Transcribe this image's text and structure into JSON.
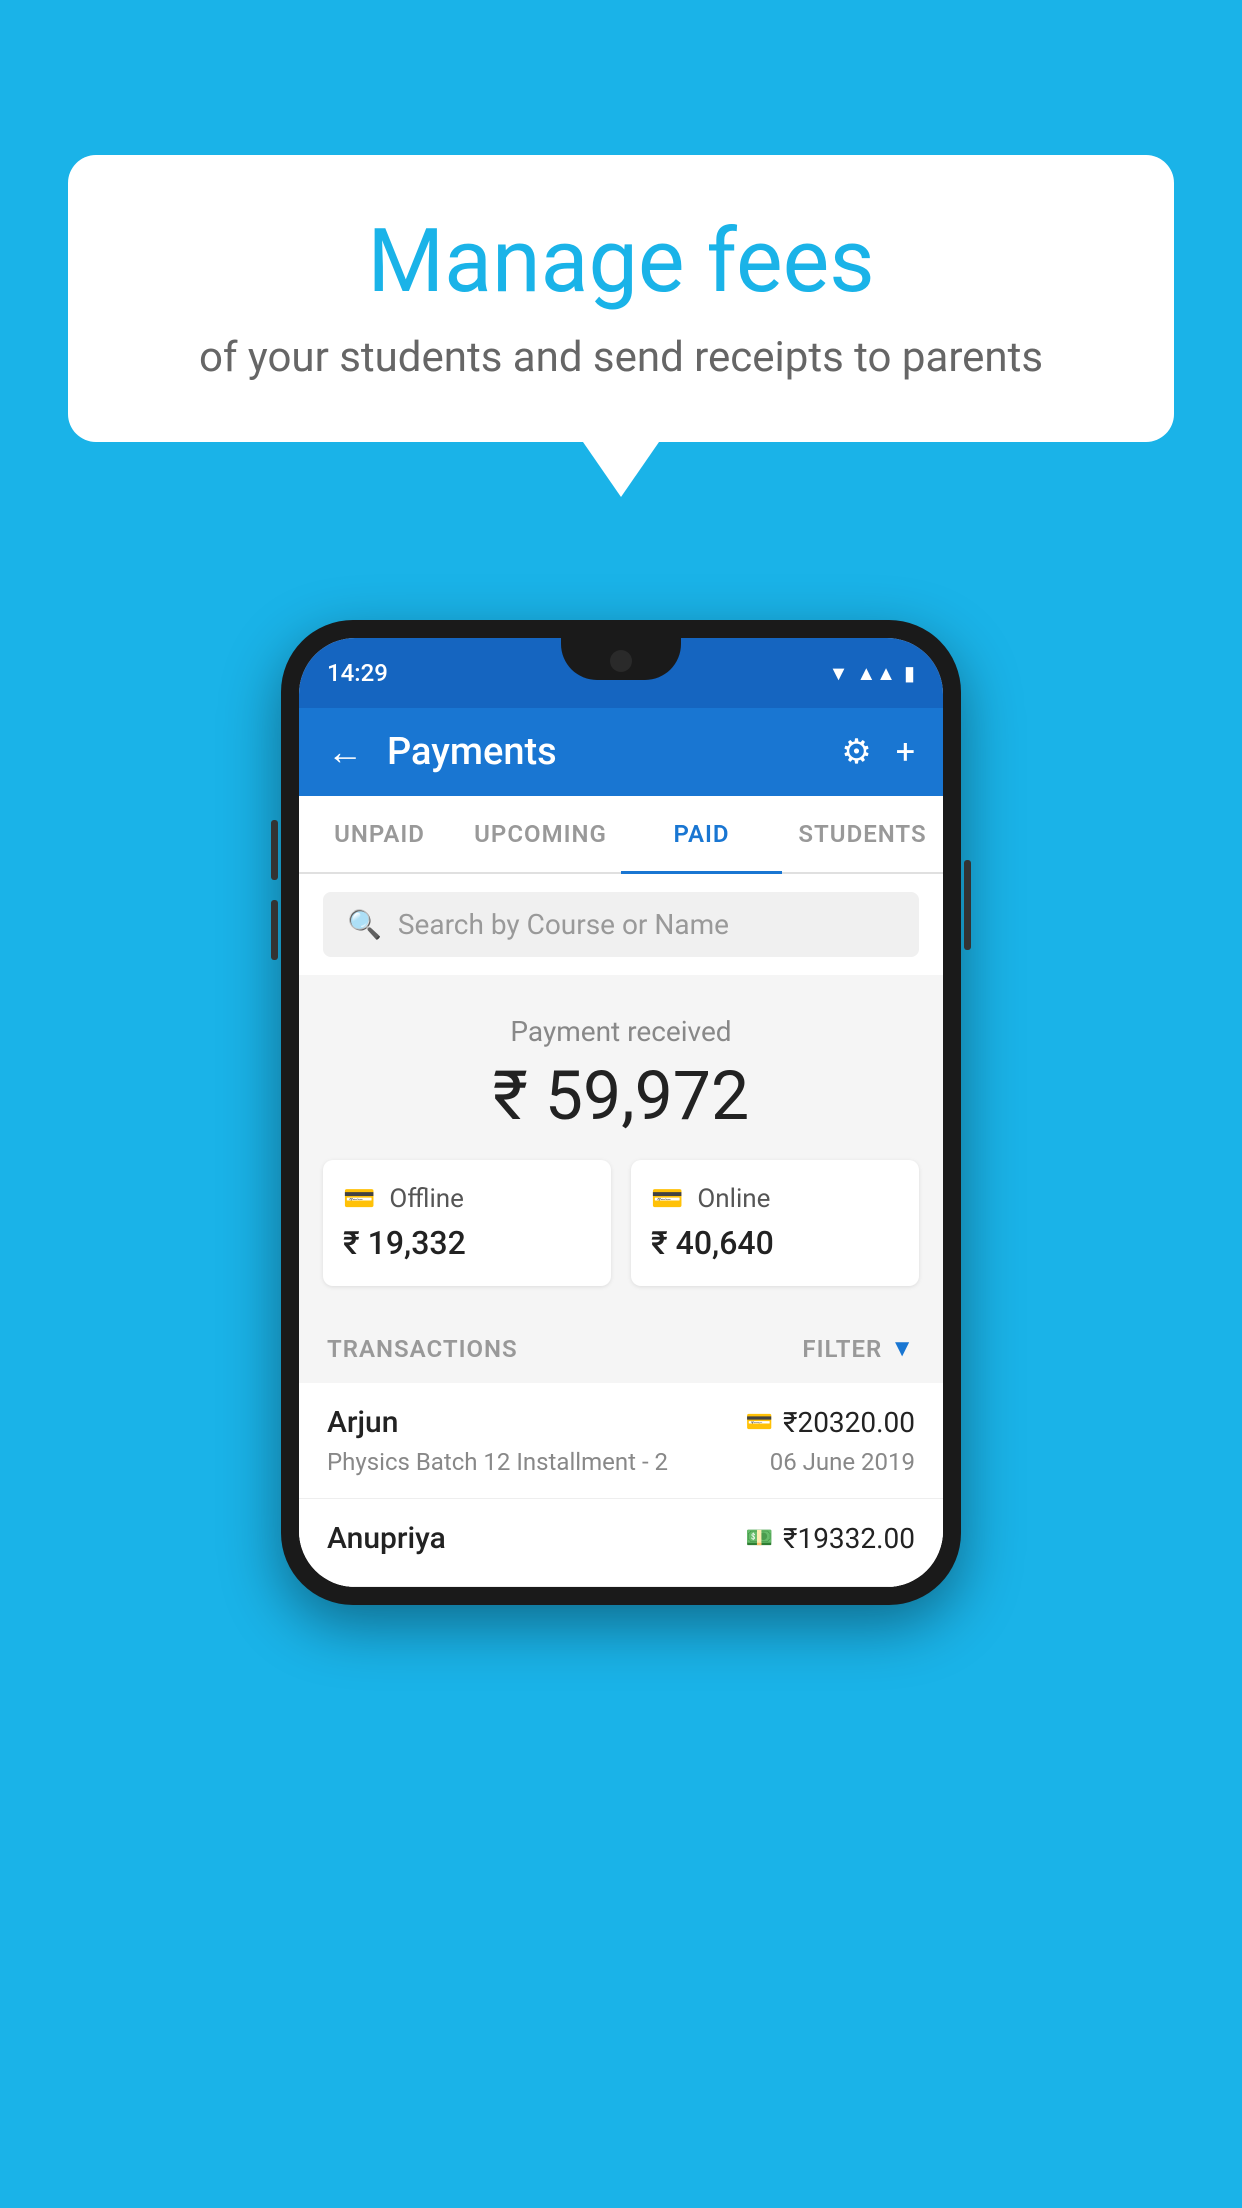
{
  "background_color": "#1ab3e8",
  "speech_bubble": {
    "title": "Manage fees",
    "subtitle": "of your students and send receipts to parents"
  },
  "phone": {
    "status_bar": {
      "time": "14:29"
    },
    "app_bar": {
      "title": "Payments",
      "back_label": "←",
      "settings_label": "⚙",
      "add_label": "+"
    },
    "tabs": [
      {
        "label": "UNPAID",
        "active": false
      },
      {
        "label": "UPCOMING",
        "active": false
      },
      {
        "label": "PAID",
        "active": true
      },
      {
        "label": "STUDENTS",
        "active": false
      }
    ],
    "search": {
      "placeholder": "Search by Course or Name"
    },
    "payment_summary": {
      "label": "Payment received",
      "amount": "₹ 59,972",
      "offline_label": "Offline",
      "offline_amount": "₹ 19,332",
      "online_label": "Online",
      "online_amount": "₹ 40,640"
    },
    "transactions": {
      "header_label": "TRANSACTIONS",
      "filter_label": "FILTER",
      "rows": [
        {
          "name": "Arjun",
          "course": "Physics Batch 12 Installment - 2",
          "amount": "₹20320.00",
          "date": "06 June 2019",
          "type": "online"
        },
        {
          "name": "Anupriya",
          "course": "",
          "amount": "₹19332.00",
          "date": "",
          "type": "offline"
        }
      ]
    }
  }
}
